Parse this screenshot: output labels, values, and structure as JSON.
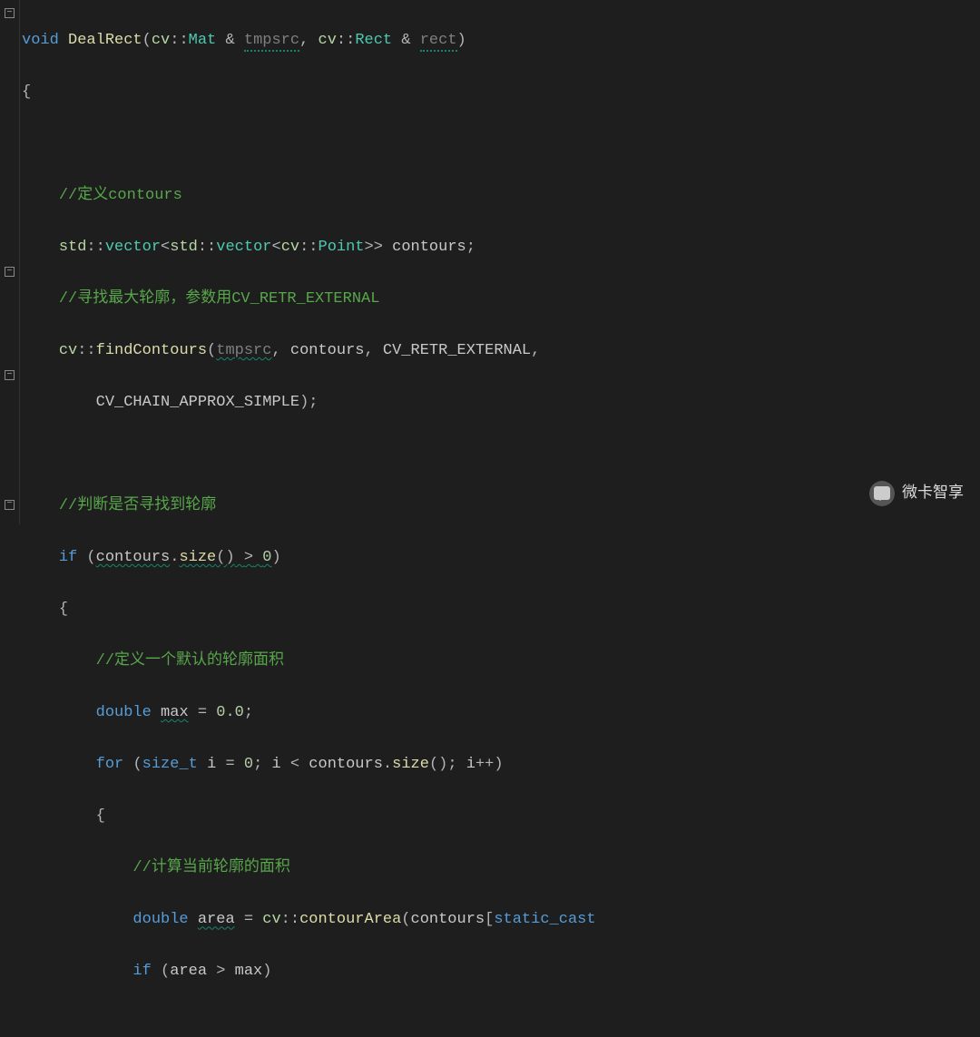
{
  "lines": {
    "l0": {
      "kw_void": "void",
      "func": "DealRect",
      "p1_ns": "cv",
      "p1_type": "Mat",
      "p1_amp": "&",
      "p1_name": "tmpsrc",
      "p2_ns": "cv",
      "p2_type": "Rect",
      "p2_amp": "&",
      "p2_name": "rect"
    },
    "l1": {
      "brace": "{"
    },
    "l3": {
      "comment": "//定义contours"
    },
    "l4": {
      "ns1": "std",
      "type1": "vector",
      "ns2": "std",
      "type2": "vector",
      "ns3": "cv",
      "type3": "Point",
      "var": "contours"
    },
    "l5": {
      "comment": "//寻找最大轮廓，参数用CV_RETR_EXTERNAL"
    },
    "l6": {
      "ns": "cv",
      "func": "findContours",
      "arg1": "tmpsrc",
      "arg2": "contours",
      "arg3": "CV_RETR_EXTERNAL"
    },
    "l7": {
      "arg4": "CV_CHAIN_APPROX_SIMPLE"
    },
    "l9": {
      "comment": "//判断是否寻找到轮廓"
    },
    "l10": {
      "kw_if": "if",
      "var": "contours",
      "method": "size",
      "op": ">",
      "num": "0"
    },
    "l11": {
      "brace": "{"
    },
    "l12": {
      "comment": "//定义一个默认的轮廓面积"
    },
    "l13": {
      "kw": "double",
      "var": "max",
      "num": "0.0"
    },
    "l14": {
      "kw_for": "for",
      "type": "size_t",
      "var": "i",
      "num0": "0",
      "var2": "i",
      "var3": "contours",
      "method": "size",
      "var4": "i"
    },
    "l15": {
      "brace": "{"
    },
    "l16": {
      "comment": "//计算当前轮廓的面积"
    },
    "l17": {
      "kw": "double",
      "var": "area",
      "ns": "cv",
      "func": "contourArea",
      "arg": "contours",
      "cast": "static_cast"
    },
    "l18": {
      "kw_if": "if",
      "var1": "area",
      "op": ">",
      "var2": "max"
    }
  },
  "watermark": "微卡智享"
}
